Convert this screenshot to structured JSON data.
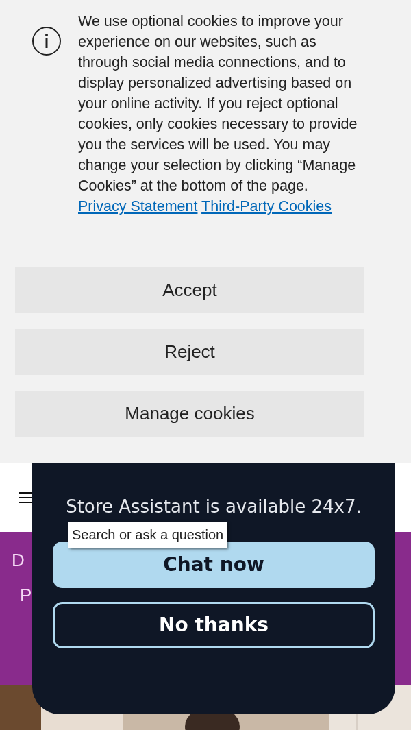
{
  "cookie_banner": {
    "message": "We use optional cookies to improve your experience on our websites, such as through social media connections, and to display personalized advertising based on your online activity. If you reject optional cookies, only cookies necessary to provide you the services will be used. You may change your selection by clicking “Manage Cookies” at the bottom of the page.",
    "links": [
      "Privacy Statement",
      "Third-Party Cookies"
    ],
    "buttons": [
      "Accept",
      "Reject",
      "Manage cookies"
    ]
  },
  "promo_band": {
    "texts": [
      "D",
      "P"
    ]
  },
  "chat_dialog": {
    "message": "Store Assistant is available 24x7.",
    "tooltip": "Search or ask a question",
    "buttons": [
      {
        "label": "Chat now",
        "kind": "primary"
      },
      {
        "label": "No thanks",
        "kind": "secondary"
      }
    ]
  }
}
